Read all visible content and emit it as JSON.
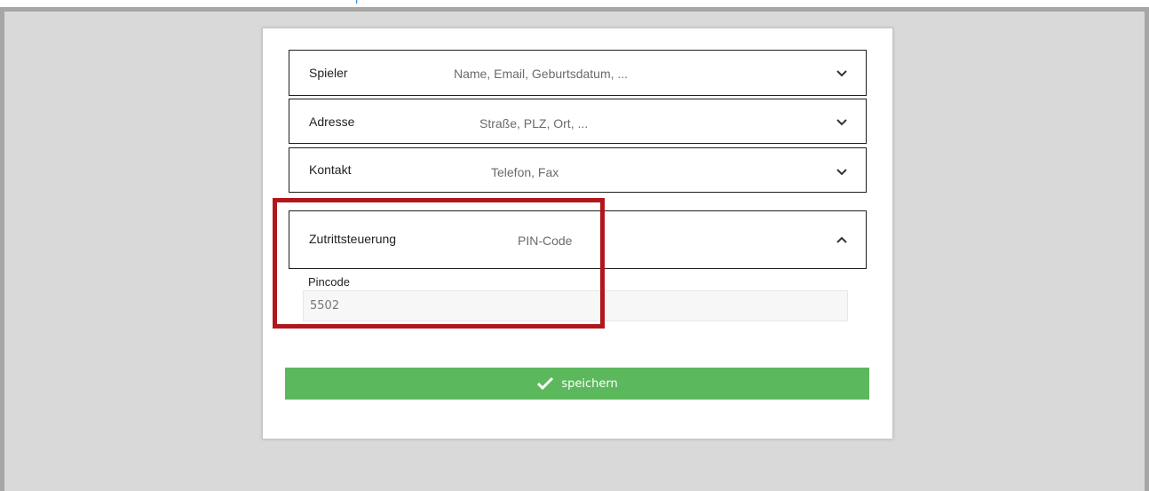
{
  "form": {
    "sections": [
      {
        "title": "Spieler",
        "subtitle": "Name, Email, Geburtsdatum, ...",
        "state": "collapsed"
      },
      {
        "title": "Adresse",
        "subtitle": "Straße, PLZ, Ort, ...",
        "state": "collapsed"
      },
      {
        "title": "Kontakt",
        "subtitle": "Telefon, Fax",
        "state": "collapsed"
      },
      {
        "title": "Zutrittsteuerung",
        "subtitle": "PIN-Code",
        "state": "expanded"
      }
    ],
    "pincode": {
      "label": "Pincode",
      "value": "5502"
    },
    "save_label": "speichern"
  },
  "colors": {
    "save_button": "#5cb85c",
    "highlight_border": "#b0171c",
    "frame_border": "#a6a6a6",
    "frame_background": "#d9d9d9"
  },
  "icons": {
    "collapsed": "chevron-down-icon",
    "expanded": "chevron-up-icon",
    "save": "checkmark-icon"
  }
}
